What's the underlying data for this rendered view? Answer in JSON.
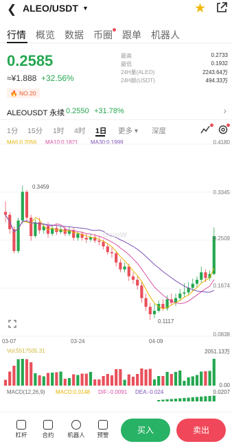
{
  "header": {
    "pair": "ALEO/USDT"
  },
  "tabs": [
    "行情",
    "概览",
    "数据",
    "币圈",
    "跟单",
    "机器人"
  ],
  "price": {
    "last": "0.2585",
    "cny": "≈¥1.888",
    "change": "+32.56%",
    "rank": "NO.20"
  },
  "stats": [
    {
      "label": "最高",
      "value": "0.2733"
    },
    {
      "label": "最低",
      "value": "0.1932"
    },
    {
      "label": "24H量(ALEO)",
      "value": "2243.64万"
    },
    {
      "label": "24H额(USDT)",
      "value": "494.33万"
    }
  ],
  "perpetual": {
    "name": "ALEOUSDT 永续",
    "price": "0.2550",
    "change": "+31.78%"
  },
  "intervals": [
    "1分",
    "15分",
    "1时",
    "4时",
    "1日",
    "更多",
    "深度"
  ],
  "ma": {
    "ma5": "MA5:0.2056",
    "ma10": "MA10:0.1821",
    "ma30": "MA30:0.1999"
  },
  "colors": {
    "up": "#25a750",
    "down": "#e8505b",
    "ma5": "#e5b400",
    "ma10": "#d94fa3",
    "ma30": "#7b4fb6"
  },
  "chart_data": {
    "type": "candlestick",
    "y_ticks": [
      "0.4180",
      "0.3345",
      "0.2509",
      "0.1674",
      "0.0838"
    ],
    "ylim": [
      0.0838,
      0.418
    ],
    "x_ticks": [
      "03-07",
      "03-24",
      "04-09"
    ],
    "annotations": {
      "high": "0.3459",
      "low": "0.1117"
    },
    "watermark": "CoinW",
    "candles": [
      [
        0.3,
        0.295,
        0.318,
        0.282
      ],
      [
        0.295,
        0.27,
        0.3,
        0.262
      ],
      [
        0.27,
        0.232,
        0.275,
        0.228
      ],
      [
        0.232,
        0.285,
        0.29,
        0.228
      ],
      [
        0.285,
        0.335,
        0.346,
        0.28
      ],
      [
        0.335,
        0.29,
        0.338,
        0.282
      ],
      [
        0.29,
        0.258,
        0.295,
        0.25
      ],
      [
        0.258,
        0.282,
        0.287,
        0.255
      ],
      [
        0.282,
        0.268,
        0.29,
        0.262
      ],
      [
        0.268,
        0.275,
        0.28,
        0.262
      ],
      [
        0.275,
        0.262,
        0.282,
        0.255
      ],
      [
        0.262,
        0.272,
        0.277,
        0.258
      ],
      [
        0.272,
        0.265,
        0.278,
        0.26
      ],
      [
        0.265,
        0.27,
        0.276,
        0.262
      ],
      [
        0.27,
        0.262,
        0.275,
        0.258
      ],
      [
        0.262,
        0.268,
        0.274,
        0.258
      ],
      [
        0.268,
        0.255,
        0.272,
        0.25
      ],
      [
        0.255,
        0.262,
        0.266,
        0.25
      ],
      [
        0.262,
        0.255,
        0.266,
        0.25
      ],
      [
        0.255,
        0.252,
        0.262,
        0.246
      ],
      [
        0.252,
        0.256,
        0.262,
        0.248
      ],
      [
        0.256,
        0.25,
        0.262,
        0.246
      ],
      [
        0.25,
        0.248,
        0.258,
        0.242
      ],
      [
        0.248,
        0.24,
        0.252,
        0.235
      ],
      [
        0.24,
        0.23,
        0.245,
        0.226
      ],
      [
        0.23,
        0.228,
        0.238,
        0.22
      ],
      [
        0.228,
        0.212,
        0.232,
        0.205
      ],
      [
        0.212,
        0.2,
        0.218,
        0.195
      ],
      [
        0.2,
        0.205,
        0.212,
        0.195
      ],
      [
        0.205,
        0.188,
        0.21,
        0.18
      ],
      [
        0.188,
        0.182,
        0.195,
        0.175
      ],
      [
        0.182,
        0.172,
        0.188,
        0.165
      ],
      [
        0.172,
        0.15,
        0.178,
        0.142
      ],
      [
        0.15,
        0.135,
        0.158,
        0.128
      ],
      [
        0.135,
        0.122,
        0.142,
        0.112
      ],
      [
        0.122,
        0.128,
        0.14,
        0.115
      ],
      [
        0.128,
        0.14,
        0.146,
        0.125
      ],
      [
        0.14,
        0.132,
        0.148,
        0.128
      ],
      [
        0.132,
        0.148,
        0.155,
        0.128
      ],
      [
        0.148,
        0.142,
        0.158,
        0.138
      ],
      [
        0.142,
        0.15,
        0.158,
        0.136
      ],
      [
        0.15,
        0.158,
        0.166,
        0.145
      ],
      [
        0.158,
        0.16,
        0.176,
        0.152
      ],
      [
        0.16,
        0.168,
        0.178,
        0.155
      ],
      [
        0.168,
        0.175,
        0.184,
        0.162
      ],
      [
        0.175,
        0.182,
        0.188,
        0.168
      ],
      [
        0.182,
        0.195,
        0.205,
        0.176
      ],
      [
        0.195,
        0.185,
        0.2,
        0.178
      ],
      [
        0.185,
        0.192,
        0.198,
        0.18
      ],
      [
        0.192,
        0.258,
        0.273,
        0.19
      ]
    ],
    "volume": {
      "label": "Vol:5517505.31",
      "max_label": "2051.13万",
      "zero_label": "0.00"
    },
    "macd": {
      "params": "MACD(12,26,9)",
      "macd": "MACD:0.0148",
      "dif": "DIF:-0.0091",
      "dea": "DEA:-0.024",
      "right_label": "0.0207"
    }
  },
  "bottom": {
    "items": [
      "杠杆",
      "合约",
      "机器人",
      "预警"
    ],
    "buy": "买入",
    "sell": "卖出"
  }
}
